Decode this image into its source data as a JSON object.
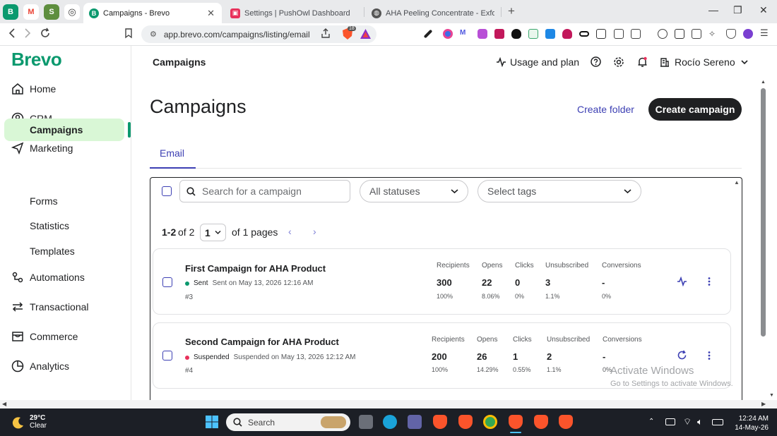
{
  "browser": {
    "pinned_tabs": [
      {
        "icon": "brevo-pinned-icon",
        "letter": "B",
        "color": "#0b996e"
      },
      {
        "icon": "gmail-icon",
        "letter": "M",
        "color": "#ea4335"
      },
      {
        "icon": "shopify-icon",
        "letter": "S",
        "color": "#5e8e3e"
      },
      {
        "icon": "openai-icon",
        "letter": "◎",
        "color": "#3a3a3a"
      }
    ],
    "tabs": [
      {
        "title": "Campaigns - Brevo",
        "active": true,
        "color": "#0b996e",
        "letter": "B"
      },
      {
        "title": "Settings | PushOwl Dashboard",
        "active": false,
        "color": "#e8315b",
        "letter": "▣"
      },
      {
        "title": "AHA Peeling Concentrate - Exfoliate",
        "active": false,
        "color": "#444444",
        "letter": "◍"
      }
    ],
    "url": "app.brevo.com/campaigns/listing/email",
    "shield_count": "18"
  },
  "sidebar": {
    "logo": "Brevo",
    "items": [
      {
        "label": "Home",
        "icon": "home-icon"
      },
      {
        "label": "CRM",
        "icon": "crm-icon"
      },
      {
        "label": "Marketing",
        "icon": "marketing-send-icon"
      },
      {
        "label": "Automations",
        "icon": "automations-icon"
      },
      {
        "label": "Transactional",
        "icon": "transactional-icon"
      },
      {
        "label": "Commerce",
        "icon": "commerce-icon"
      },
      {
        "label": "Analytics",
        "icon": "analytics-icon"
      }
    ],
    "marketing_sub": [
      "Campaigns",
      "Forms",
      "Statistics",
      "Templates"
    ],
    "active_sub": "Campaigns"
  },
  "header": {
    "section": "Campaigns",
    "usage": "Usage and plan",
    "user": "Rocío Sereno"
  },
  "main": {
    "title": "Campaigns",
    "create_folder": "Create folder",
    "create_campaign": "Create campaign",
    "tab": "Email",
    "search_placeholder": "Search for a campaign",
    "status_filter": "All statuses",
    "tags_filter": "Select tags",
    "pagination": {
      "range": "1-2",
      "of_total": "of 2",
      "page": "1",
      "of_pages": "of 1 pages"
    }
  },
  "campaigns": [
    {
      "name": "First Campaign for AHA Product",
      "status": "Sent",
      "status_color": "#0b996e",
      "status_detail": "Sent on May 13, 2026 12:16 AM",
      "id": "#3",
      "action_icon": "activity-icon",
      "stats": [
        {
          "label": "Recipients",
          "value": "300",
          "pct": "100%"
        },
        {
          "label": "Opens",
          "value": "22",
          "pct": "8.06%"
        },
        {
          "label": "Clicks",
          "value": "0",
          "pct": "0%"
        },
        {
          "label": "Unsubscribed",
          "value": "3",
          "pct": "1.1%"
        },
        {
          "label": "Conversions",
          "value": "-",
          "pct": "0%"
        }
      ]
    },
    {
      "name": "Second Campaign for AHA Product",
      "status": "Suspended",
      "status_color": "#e8315b",
      "status_detail": "Suspended on May 13, 2026 12:12 AM",
      "id": "#4",
      "action_icon": "refresh-icon",
      "stats": [
        {
          "label": "Recipients",
          "value": "200",
          "pct": "100%"
        },
        {
          "label": "Opens",
          "value": "26",
          "pct": "14.29%"
        },
        {
          "label": "Clicks",
          "value": "1",
          "pct": "0.55%"
        },
        {
          "label": "Unsubscribed",
          "value": "2",
          "pct": "1.1%"
        },
        {
          "label": "Conversions",
          "value": "-",
          "pct": "0%"
        }
      ]
    }
  ],
  "watermark": {
    "line1": "Activate Windows",
    "line2": "Go to Settings to activate Windows."
  },
  "taskbar": {
    "temp": "29°C",
    "condition": "Clear",
    "search": "Search",
    "time": "12:24 AM",
    "date": "14-May-26"
  },
  "colors": {
    "brand_green": "#0b996e",
    "accent_purple": "#3c3fb3",
    "active_pill": "#d9f7d6"
  }
}
